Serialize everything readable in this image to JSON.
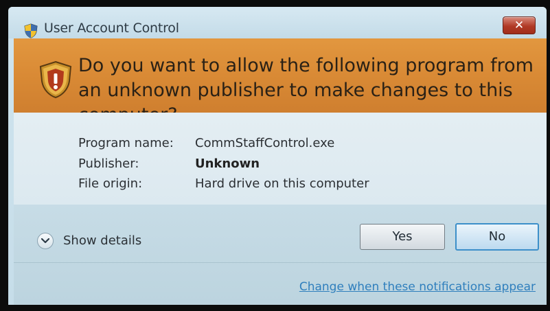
{
  "window": {
    "title": "User Account Control",
    "close_glyph": "✕",
    "title_icon": "uac-shield-icon"
  },
  "banner": {
    "icon": "warning-shield-icon",
    "question": "Do you want to allow the following program from an unknown publisher to make changes to this computer?",
    "color": "#d98a35"
  },
  "details": {
    "rows": [
      {
        "label": "Program name:",
        "value": "CommStaffControl.exe",
        "bold": false
      },
      {
        "label": "Publisher:",
        "value": "Unknown",
        "bold": true
      },
      {
        "label": "File origin:",
        "value": "Hard drive on this computer",
        "bold": false
      }
    ]
  },
  "footer": {
    "show_details_label": "Show details",
    "yes_label": "Yes",
    "no_label": "No",
    "link_label": "Change when these notifications appear",
    "link_color": "#2f7fbd"
  }
}
